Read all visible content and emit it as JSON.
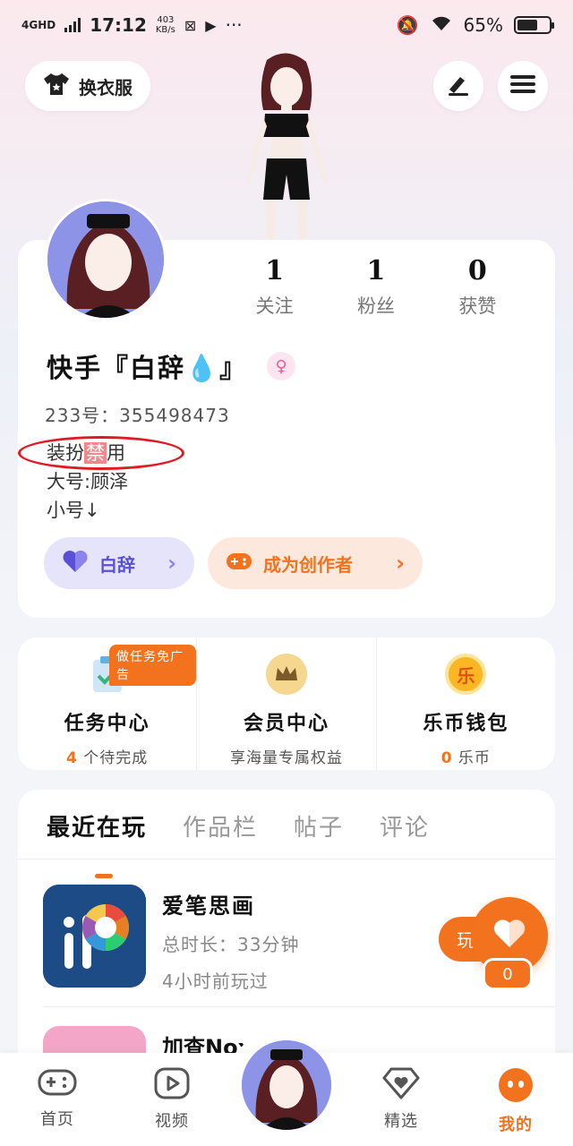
{
  "status_bar": {
    "network": "4GHD",
    "time": "17:12",
    "speed_value": "403",
    "speed_unit": "KB/s",
    "more": "···",
    "battery": "65%"
  },
  "header": {
    "outfit_button": "换衣服"
  },
  "profile": {
    "stats": [
      {
        "value": "1",
        "label": "关注"
      },
      {
        "value": "1",
        "label": "粉丝"
      },
      {
        "value": "0",
        "label": "获赞"
      }
    ],
    "name": "快手『白辞💧』",
    "gender_symbol": "♀",
    "id_line": "233号：355498473",
    "bio_line1_a": "装扮",
    "bio_line1_ban": "禁",
    "bio_line1_b": "用",
    "bio_line2": "大号:顾泽",
    "bio_line3": "小号↓",
    "user_pill": "白辞",
    "creator_pill": "成为创作者",
    "chevron": "›"
  },
  "services": [
    {
      "title": "任务中心",
      "sub_highlight": "4",
      "sub": " 个待完成",
      "badge": "做任务免广告"
    },
    {
      "title": "会员中心",
      "sub_highlight": "",
      "sub": "享海量专属权益",
      "badge": ""
    },
    {
      "title": "乐币钱包",
      "sub_highlight": "0",
      "sub": " 乐币",
      "badge": ""
    }
  ],
  "wallet_icon_char": "乐",
  "tabs": [
    "最近在玩",
    "作品栏",
    "帖子",
    "评论"
  ],
  "games": [
    {
      "name": "爱笔思画",
      "duration": "总时长：33分钟",
      "last_played": "4小时前玩过",
      "play": "玩"
    },
    {
      "name": "加查Nox"
    }
  ],
  "fab": {
    "badge": "0"
  },
  "bottom_nav": [
    {
      "label": "首页"
    },
    {
      "label": "视频"
    },
    {
      "label": "精选"
    },
    {
      "label": "我的"
    }
  ],
  "colors": {
    "accent": "#f2721d",
    "purple": "#5a50d8",
    "circle_mark": "#e01a24"
  }
}
